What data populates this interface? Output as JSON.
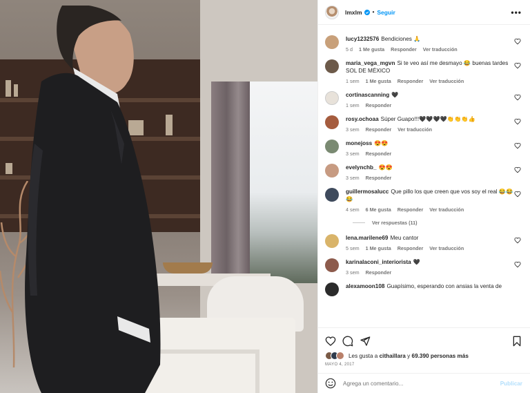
{
  "post": {
    "username": "lmxlm",
    "dot": "•",
    "follow_label": "Seguir",
    "more_label": "•••"
  },
  "comments": [
    {
      "user": "lucy1232576",
      "text": "Bendiciones 🙏",
      "time": "5 d",
      "likes": "1 Me gusta",
      "reply": "Responder",
      "translate": "Ver traducción",
      "avatar_color": "#c8a07a"
    },
    {
      "user": "maria_vega_mgvn",
      "text": "Si te veo así me desmayo 😂 buenas tardes SOL DE MÉXICO",
      "time": "1 sem",
      "likes": "1 Me gusta",
      "reply": "Responder",
      "translate": "Ver traducción",
      "avatar_color": "#6d5a4a"
    },
    {
      "user": "cortinascanning",
      "text": "🖤",
      "time": "1 sem",
      "likes": "",
      "reply": "Responder",
      "translate": "",
      "avatar_color": "#e8e2da"
    },
    {
      "user": "rosy.ochoaa",
      "text": "Súper Guapo!!!🖤🖤🖤🖤👏👏👏👍",
      "time": "3 sem",
      "likes": "",
      "reply": "Responder",
      "translate": "Ver traducción",
      "avatar_color": "#a55c3e"
    },
    {
      "user": "monejoss",
      "text": "😍😍",
      "time": "3 sem",
      "likes": "",
      "reply": "Responder",
      "translate": "",
      "avatar_color": "#7a8a72"
    },
    {
      "user": "evelynchb_",
      "text": "😍😍",
      "time": "3 sem",
      "likes": "",
      "reply": "Responder",
      "translate": "",
      "avatar_color": "#c79b82"
    },
    {
      "user": "guillermosalucc",
      "text": "Que pillo los que creen que vos soy el real 😂😂😂",
      "time": "4 sem",
      "likes": "6 Me gusta",
      "reply": "Responder",
      "translate": "Ver traducción",
      "avatar_color": "#3e4a5c",
      "replies": "Ver respuestas (11)"
    },
    {
      "user": "lena.marilene69",
      "text": "Meu cantor",
      "time": "5 sem",
      "likes": "1 Me gusta",
      "reply": "Responder",
      "translate": "Ver traducción",
      "avatar_color": "#d9b46a"
    },
    {
      "user": "karinalaconi_interiorista",
      "text": "🖤",
      "time": "3 sem",
      "likes": "",
      "reply": "Responder",
      "translate": "",
      "avatar_color": "#8d5b4c"
    },
    {
      "user": "alexamoon108",
      "text": "Guapísimo, esperando con ansias la venta de",
      "time": "",
      "likes": "",
      "reply": "",
      "translate": "",
      "avatar_color": "#2b2b2b"
    }
  ],
  "actions": {
    "likes_prefix": "Les gusta a",
    "likes_user": "cithaillara",
    "likes_suffix": "y",
    "likes_count": "69.390 personas más",
    "date": "MAYO 4, 2017"
  },
  "add_comment": {
    "placeholder": "Agrega un comentario...",
    "publish_label": "Publicar"
  },
  "colors": {
    "accent": "#0095f6",
    "publish_disabled": "#b2dffc",
    "muted": "#737373"
  },
  "icons": [
    "verified-icon",
    "more-icon",
    "heart-icon",
    "comment-icon",
    "share-icon",
    "bookmark-icon",
    "emoji-icon"
  ]
}
